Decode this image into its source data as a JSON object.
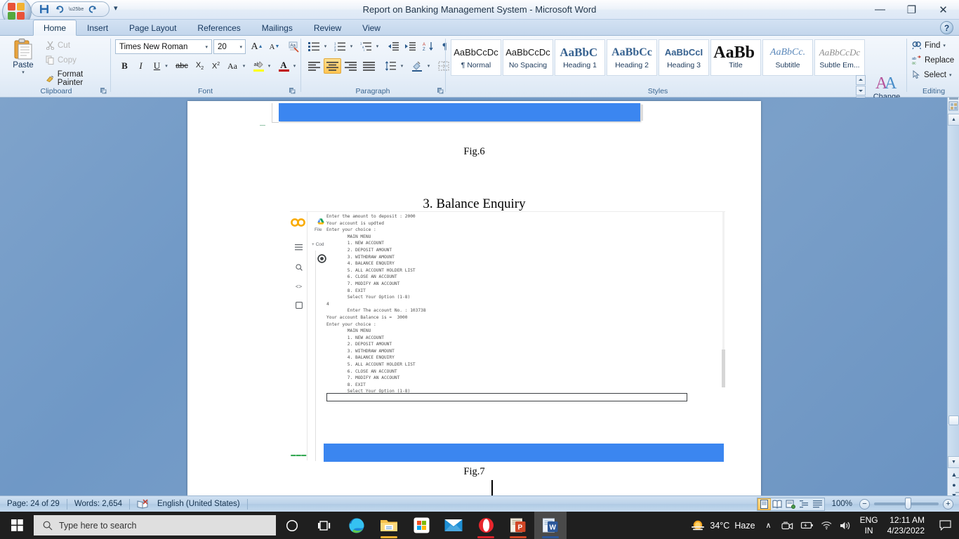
{
  "window": {
    "title": "Report on Banking Management System - Microsoft Word",
    "minimize": "—",
    "restore": "❐",
    "close": "✕",
    "help": "?",
    "qat": {
      "save": "save-icon",
      "undo": "undo-icon",
      "redo": "redo-icon",
      "more": "▾"
    }
  },
  "tabs": [
    {
      "label": "Home",
      "active": true
    },
    {
      "label": "Insert",
      "active": false
    },
    {
      "label": "Page Layout",
      "active": false
    },
    {
      "label": "References",
      "active": false
    },
    {
      "label": "Mailings",
      "active": false
    },
    {
      "label": "Review",
      "active": false
    },
    {
      "label": "View",
      "active": false
    }
  ],
  "ribbon": {
    "clipboard": {
      "label": "Clipboard",
      "paste": "Paste",
      "paste_caret": "▾",
      "cut": "Cut",
      "copy": "Copy",
      "format_painter": "Format Painter"
    },
    "font": {
      "label": "Font",
      "font_name": "Times New Roman",
      "font_size": "20",
      "grow_font": "A",
      "shrink_font": "A",
      "clear_formatting": "Aa",
      "bold": "B",
      "italic": "I",
      "underline": "U",
      "strikethrough": "abc",
      "subscript": "X₂",
      "superscript": "X²",
      "change_case": "Aa",
      "highlight": "ab",
      "font_color": "A"
    },
    "paragraph": {
      "label": "Paragraph",
      "bullets": "bullets-icon",
      "numbering": "numbering-icon",
      "multilevel": "multilevel-list-icon",
      "decrease_indent": "decrease-indent-icon",
      "increase_indent": "increase-indent-icon",
      "sort": "sort-icon",
      "show_marks": "¶",
      "align_left": "align-left-icon",
      "align_center": "align-center-icon",
      "align_right": "align-right-icon",
      "justify": "justify-icon",
      "line_spacing": "line-spacing-icon",
      "shading": "shading-icon",
      "borders": "borders-icon"
    },
    "styles": {
      "label": "Styles",
      "items": [
        {
          "preview": "AaBbCcDc",
          "name": "¶ Normal",
          "font": "sans",
          "color": "#1a1a1a",
          "size": "13px",
          "weight": "normal",
          "style": "normal"
        },
        {
          "preview": "AaBbCcDc",
          "name": "No Spacing",
          "font": "sans",
          "color": "#1a1a1a",
          "size": "13px",
          "weight": "normal",
          "style": "normal"
        },
        {
          "preview": "AaBbC ",
          "name": "Heading 1",
          "font": "serif",
          "color": "#36618f",
          "size": "17px",
          "weight": "bold",
          "style": "normal"
        },
        {
          "preview": "AaBbCc",
          "name": "Heading 2",
          "font": "serif",
          "color": "#36618f",
          "size": "16px",
          "weight": "bold",
          "style": "normal"
        },
        {
          "preview": "AaBbCcI",
          "name": "Heading 3",
          "font": "sans",
          "color": "#36618f",
          "size": "13px",
          "weight": "bold",
          "style": "normal"
        },
        {
          "preview": "AaBb ",
          "name": "Title",
          "font": "serif",
          "color": "#111111",
          "size": "24px",
          "weight": "bold",
          "style": "normal"
        },
        {
          "preview": "AaBbCc.",
          "name": "Subtitle",
          "font": "serif",
          "color": "#5b88ba",
          "size": "14px",
          "weight": "normal",
          "style": "italic"
        },
        {
          "preview": "AaBbCcDc",
          "name": "Subtle Em...",
          "font": "serif",
          "color": "#8e8e8e",
          "size": "13px",
          "weight": "normal",
          "style": "italic"
        }
      ],
      "scroll_up": "▴",
      "scroll_down": "▾",
      "more": "⨍",
      "change_styles": "Change Styles",
      "change_styles_caret": "▾"
    },
    "editing": {
      "label": "Editing",
      "find": "Find",
      "find_caret": "▾",
      "replace": "Replace",
      "select": "Select",
      "select_caret": "▾"
    }
  },
  "document": {
    "fig6_caption": "Fig.6",
    "heading": "3.  Balance Enquiry",
    "fig7_caption": "Fig.7",
    "colab": {
      "logo": "colab-logo",
      "drive_icon": "drive-icon",
      "menu_file": "File",
      "add_code": "+ Cod",
      "rail": [
        "toc-icon",
        "search-icon",
        "code-snippets-icon",
        "files-icon",
        "terminal-icon"
      ],
      "terminal_lines": [
        "Enter the amount to deposit : 2000",
        "Your account is updted",
        "Enter your choice :",
        "        MAIN MENU",
        "        1. NEW ACCOUNT",
        "        2. DEPOSIT AMOUNT",
        "        3. WITHDRAW AMOUNT",
        "        4. BALANCE ENQUIRY",
        "        5. ALL ACCOUNT HOLDER LIST",
        "        6. CLOSE AN ACCOUNT",
        "        7. MODIFY AN ACCOUNT",
        "        8. EXIT",
        "        Select Your Option (1-8)",
        "4",
        "        Enter The account No. : 103738",
        "Your account Balance is =  3000",
        "Enter your choice :",
        "        MAIN MENU",
        "        1. NEW ACCOUNT",
        "        2. DEPOSIT AMOUNT",
        "        3. WITHDRAW AMOUNT",
        "        4. BALANCE ENQUIRY",
        "        5. ALL ACCOUNT HOLDER LIST",
        "        6. CLOSE AN ACCOUNT",
        "        7. MODIFY AN ACCOUNT",
        "        8. EXIT",
        "        Select Your Option (1-8)"
      ]
    }
  },
  "statusbar": {
    "page": "Page: 24 of 29",
    "words": "Words: 2,654",
    "proofing_icon": "proofing-errors-icon",
    "language": "English (United States)",
    "views": [
      "print-layout-icon",
      "full-screen-reading-icon",
      "web-layout-icon",
      "outline-icon",
      "draft-icon"
    ],
    "zoom": "100%",
    "zoom_out": "−",
    "zoom_in": "+"
  },
  "taskbar": {
    "start": "start-icon",
    "search_placeholder": "Type here to search",
    "search_icon": "search-icon",
    "items": [
      {
        "name": "cortana-icon",
        "active": false,
        "underline": ""
      },
      {
        "name": "task-view-icon",
        "active": false,
        "underline": ""
      },
      {
        "name": "microsoft-edge-icon",
        "active": false,
        "underline": ""
      },
      {
        "name": "file-explorer-icon",
        "active": false,
        "underline": "#f2b233"
      },
      {
        "name": "microsoft-store-icon",
        "active": false,
        "underline": ""
      },
      {
        "name": "mail-icon",
        "active": false,
        "underline": ""
      },
      {
        "name": "opera-icon",
        "active": false,
        "underline": "#d8222a"
      },
      {
        "name": "powerpoint-icon",
        "active": false,
        "underline": "#d24726"
      },
      {
        "name": "word-icon",
        "active": true,
        "underline": "#2b579a"
      }
    ],
    "tray": {
      "weather_temp": "34°C",
      "weather_cond": "Haze",
      "chevron": "∧",
      "meet_icon": "meet-now-icon",
      "battery_icon": "battery-charging-icon",
      "network_icon": "wifi-icon",
      "volume_icon": "volume-icon",
      "lang_line1": "ENG",
      "lang_line2": "IN",
      "time": "12:11 AM",
      "date": "4/23/2022",
      "action_center": "action-center-icon"
    }
  }
}
